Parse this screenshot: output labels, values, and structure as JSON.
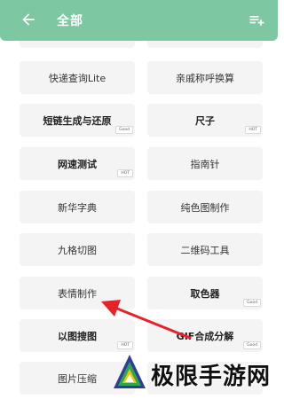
{
  "header": {
    "title": "全部",
    "back_icon": "back-arrow-icon",
    "menu_icon": "playlist-add-icon",
    "bg_color": "#7dc8a2"
  },
  "tools": [
    {
      "label": "快递查询Lite",
      "badge": ""
    },
    {
      "label": "亲戚称呼换算",
      "badge": ""
    },
    {
      "label": "短链生成与还原",
      "badge": "Good"
    },
    {
      "label": "尺子",
      "badge": "HOT"
    },
    {
      "label": "网速测试",
      "badge": "HOT"
    },
    {
      "label": "指南针",
      "badge": ""
    },
    {
      "label": "新华字典",
      "badge": ""
    },
    {
      "label": "纯色图制作",
      "badge": ""
    },
    {
      "label": "九格切图",
      "badge": ""
    },
    {
      "label": "二维码工具",
      "badge": ""
    },
    {
      "label": "表情制作",
      "badge": ""
    },
    {
      "label": "取色器",
      "badge": "Good"
    },
    {
      "label": "以图搜图",
      "badge": "HOT"
    },
    {
      "label": "GIF合成分解",
      "badge": "Good"
    },
    {
      "label": "图片压缩",
      "badge": ""
    }
  ],
  "annotation": {
    "color": "#e8212a"
  },
  "watermark": {
    "text": "极限手游网"
  }
}
